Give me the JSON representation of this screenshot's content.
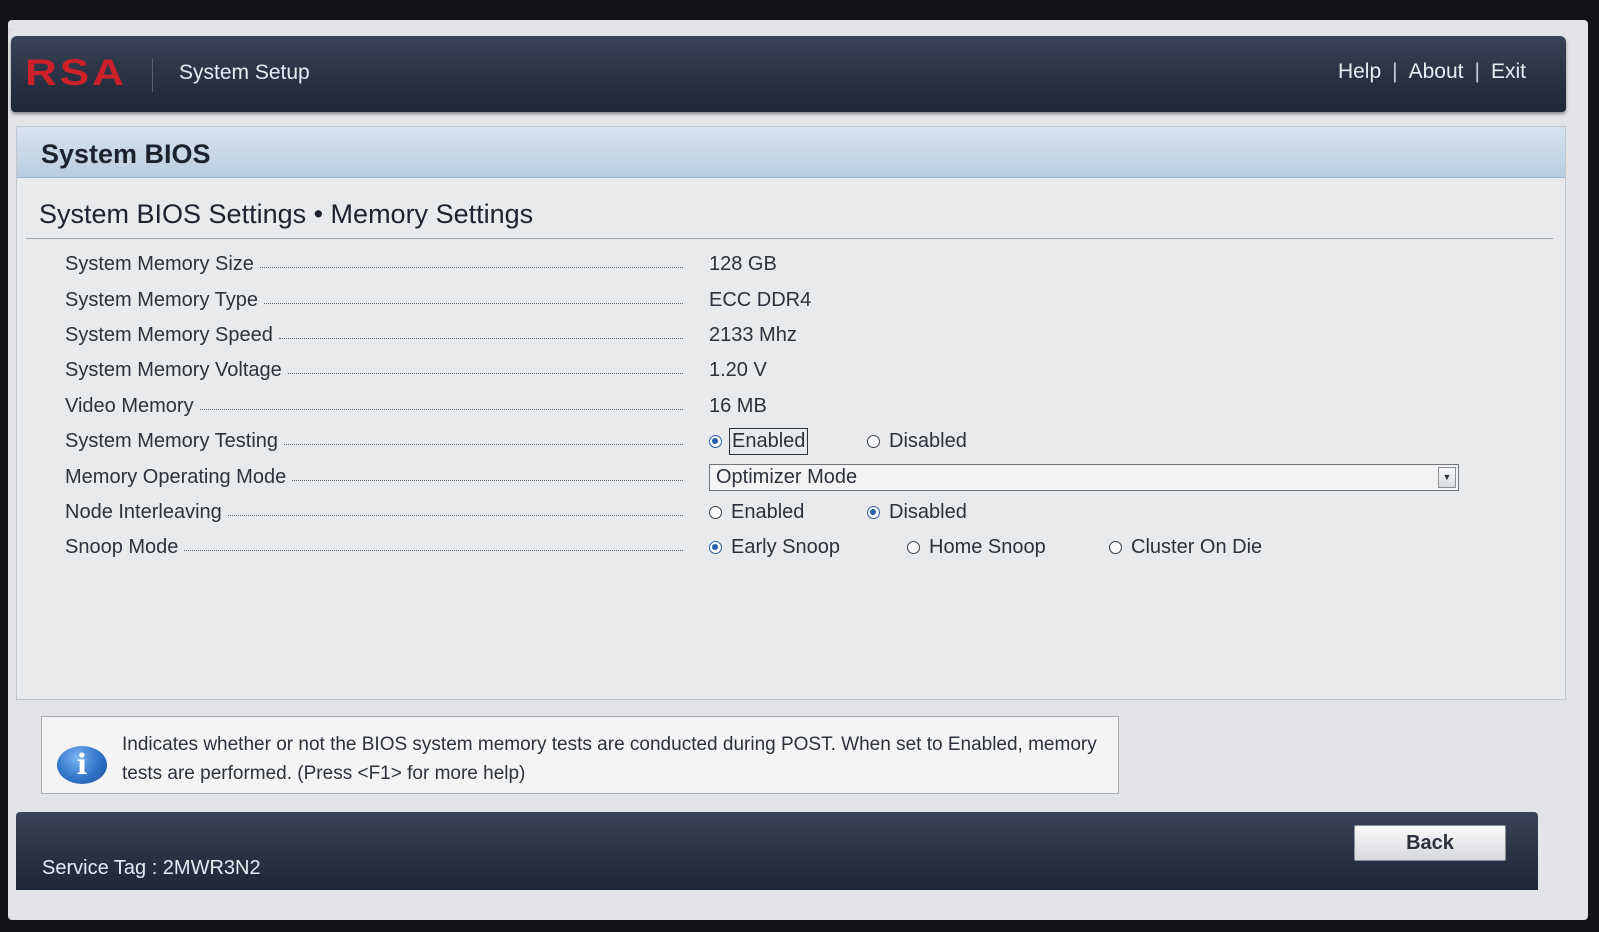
{
  "header": {
    "logo": "RSA",
    "app_title": "System Setup",
    "links": {
      "help": "Help",
      "about": "About",
      "exit": "Exit"
    },
    "separator": "|"
  },
  "page": {
    "title": "System BIOS",
    "section_title": "System BIOS Settings • Memory Settings"
  },
  "settings": {
    "memory_size": {
      "label": "System Memory Size",
      "value": "128 GB"
    },
    "memory_type": {
      "label": "System Memory Type",
      "value": "ECC DDR4"
    },
    "memory_speed": {
      "label": "System Memory Speed",
      "value": "2133 Mhz"
    },
    "memory_voltage": {
      "label": "System Memory Voltage",
      "value": "1.20 V"
    },
    "video_memory": {
      "label": "Video Memory",
      "value": "16 MB"
    },
    "memory_testing": {
      "label": "System Memory Testing",
      "options": [
        "Enabled",
        "Disabled"
      ],
      "selected": "Enabled"
    },
    "operating_mode": {
      "label": "Memory Operating Mode",
      "value": "Optimizer Mode"
    },
    "node_interleaving": {
      "label": "Node Interleaving",
      "options": [
        "Enabled",
        "Disabled"
      ],
      "selected": "Disabled"
    },
    "snoop_mode": {
      "label": "Snoop Mode",
      "options": [
        "Early Snoop",
        "Home Snoop",
        "Cluster On Die"
      ],
      "selected": "Early Snoop"
    }
  },
  "help": {
    "icon": "info-icon",
    "icon_glyph": "i",
    "text": "Indicates whether or not the BIOS system memory tests are conducted during POST. When set to Enabled, memory tests are performed. (Press <F1> for more help)"
  },
  "footer": {
    "service_tag": "Service Tag : 2MWR3N2",
    "back_label": "Back"
  },
  "colors": {
    "header_bg": "#283043",
    "logo_red": "#cc2128",
    "title_strip": "#b8cde1",
    "panel_bg": "#e9eaec",
    "radio_selected": "#2a5fae"
  }
}
